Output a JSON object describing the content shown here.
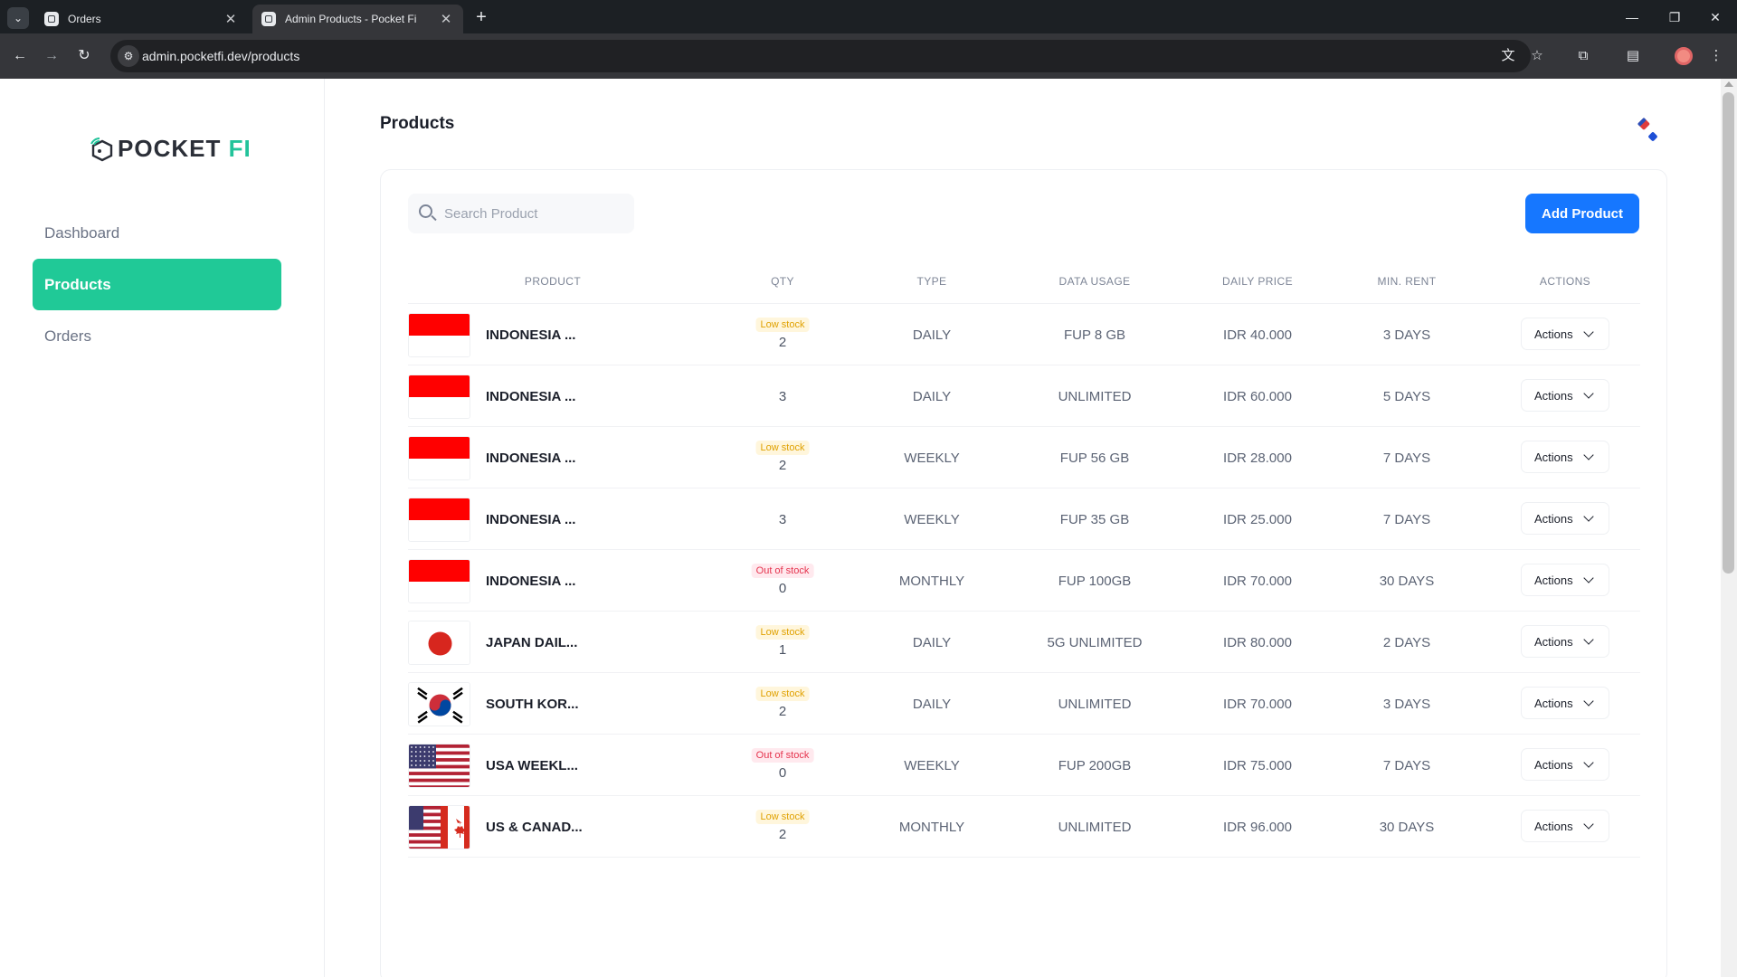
{
  "browser": {
    "tabs": [
      {
        "title": "Orders",
        "active": false
      },
      {
        "title": "Admin Products - Pocket Fi",
        "active": true
      }
    ],
    "url": "admin.pocketfi.dev/products"
  },
  "sidebar": {
    "logo": {
      "part1": "POCKET ",
      "part2": "FI"
    },
    "items": [
      {
        "label": "Dashboard",
        "active": false
      },
      {
        "label": "Products",
        "active": true
      },
      {
        "label": "Orders",
        "active": false
      }
    ]
  },
  "main": {
    "title": "Products",
    "search": {
      "placeholder": "Search Product"
    },
    "add_button": "Add Product",
    "columns": [
      "PRODUCT",
      "QTY",
      "TYPE",
      "DATA USAGE",
      "DAILY PRICE",
      "MIN. RENT",
      "ACTIONS"
    ],
    "rows": [
      {
        "flag": "indonesia-flag",
        "name": "INDONESIA ...",
        "badge": "Low stock",
        "badge_type": "low",
        "qty": "2",
        "type": "DAILY",
        "data": "FUP 8 GB",
        "price": "IDR 40.000",
        "rent": "3 DAYS",
        "action": "Actions"
      },
      {
        "flag": "indonesia-flag",
        "name": "INDONESIA ...",
        "badge": "",
        "badge_type": "",
        "qty": "3",
        "type": "DAILY",
        "data": "UNLIMITED",
        "price": "IDR 60.000",
        "rent": "5 DAYS",
        "action": "Actions"
      },
      {
        "flag": "indonesia-flag",
        "name": "INDONESIA ...",
        "badge": "Low stock",
        "badge_type": "low",
        "qty": "2",
        "type": "WEEKLY",
        "data": "FUP 56 GB",
        "price": "IDR 28.000",
        "rent": "7 DAYS",
        "action": "Actions"
      },
      {
        "flag": "indonesia-flag",
        "name": "INDONESIA ...",
        "badge": "",
        "badge_type": "",
        "qty": "3",
        "type": "WEEKLY",
        "data": "FUP 35 GB",
        "price": "IDR 25.000",
        "rent": "7 DAYS",
        "action": "Actions"
      },
      {
        "flag": "indonesia-flag",
        "name": "INDONESIA ...",
        "badge": "Out of stock",
        "badge_type": "out",
        "qty": "0",
        "type": "MONTHLY",
        "data": "FUP 100GB",
        "price": "IDR 70.000",
        "rent": "30 DAYS",
        "action": "Actions"
      },
      {
        "flag": "japan-flag",
        "name": "JAPAN DAIL...",
        "badge": "Low stock",
        "badge_type": "low",
        "qty": "1",
        "type": "DAILY",
        "data": "5G UNLIMITED",
        "price": "IDR 80.000",
        "rent": "2 DAYS",
        "action": "Actions"
      },
      {
        "flag": "south-korea-flag",
        "name": "SOUTH KOR...",
        "badge": "Low stock",
        "badge_type": "low",
        "qty": "2",
        "type": "DAILY",
        "data": "UNLIMITED",
        "price": "IDR 70.000",
        "rent": "3 DAYS",
        "action": "Actions"
      },
      {
        "flag": "usa-flag",
        "name": "USA WEEKL...",
        "badge": "Out of stock",
        "badge_type": "out",
        "qty": "0",
        "type": "WEEKLY",
        "data": "FUP 200GB",
        "price": "IDR 75.000",
        "rent": "7 DAYS",
        "action": "Actions"
      },
      {
        "flag": "usa-canada-flag",
        "name": "US & CANAD...",
        "badge": "Low stock",
        "badge_type": "low",
        "qty": "2",
        "type": "MONTHLY",
        "data": "UNLIMITED",
        "price": "IDR 96.000",
        "rent": "30 DAYS",
        "action": "Actions"
      }
    ]
  },
  "colors": {
    "accent": "#20c997",
    "primary": "#1677ff",
    "low_stock": "#e0a100",
    "out_stock": "#e5334d"
  }
}
